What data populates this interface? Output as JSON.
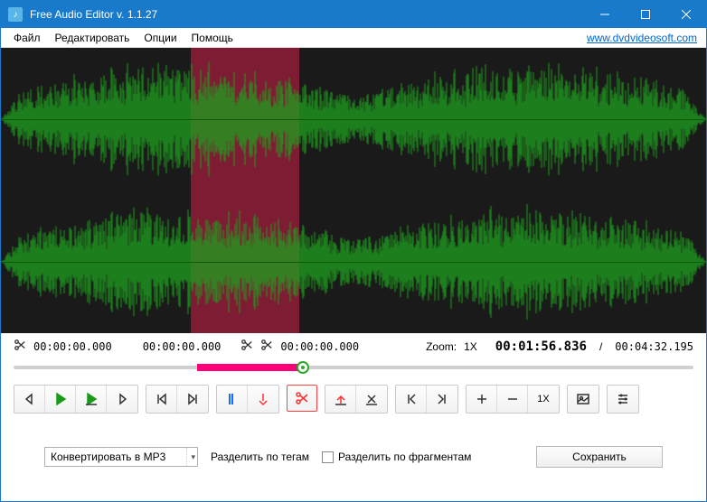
{
  "titlebar": {
    "title": "Free Audio Editor v. 1.1.27"
  },
  "menubar": {
    "items": [
      "Файл",
      "Редактировать",
      "Опции",
      "Помощь"
    ],
    "link": "www.dvdvideosoft.com"
  },
  "times": {
    "sel_start": "00:00:00.000",
    "sel_end": "00:00:00.000",
    "sel_cut": "00:00:00.000",
    "zoom_label": "Zoom:",
    "zoom_value": "1X",
    "current": "00:01:56.836",
    "slash": "/",
    "total": "00:04:32.195"
  },
  "toolbar": {
    "zoom_reset": "1X"
  },
  "bottom": {
    "convert": "Конвертировать в MP3",
    "split_tags": "Разделить по тегам",
    "split_fragments": "Разделить по фрагментам",
    "save": "Сохранить"
  },
  "waveform": {
    "selection_start_pct": 27,
    "selection_width_pct": 15.5
  }
}
